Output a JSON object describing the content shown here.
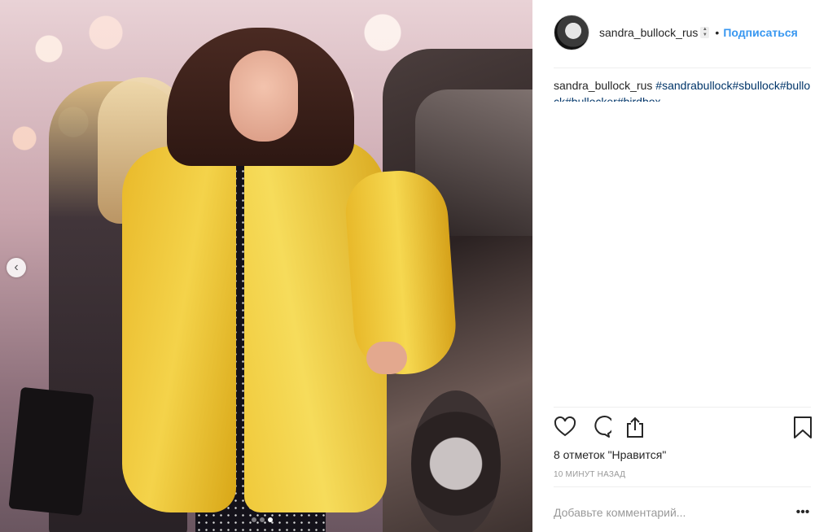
{
  "post": {
    "username": "sandra_bullock_rus",
    "separator": "•",
    "follow_label": "Подписаться",
    "caption_username": "sandra_bullock_rus",
    "caption_tags": "#sandrabullock#sbullock#bullock#bullocker#birdbox",
    "likes_text": "8 отметок \"Нравится\"",
    "timestamp": "10 МИНУТ НАЗАД",
    "comment_placeholder": "Добавьте комментарий...",
    "more_label": "•••"
  },
  "carousel": {
    "prev_icon": "chevron-left-icon",
    "slide_count": 3,
    "active_slide": 3
  },
  "icons": {
    "like": "heart-icon",
    "comment": "comment-icon",
    "share": "share-icon",
    "save": "bookmark-icon"
  },
  "colors": {
    "link": "#3897f0",
    "hashtag": "#003569",
    "text": "#262626",
    "muted": "#999999"
  }
}
